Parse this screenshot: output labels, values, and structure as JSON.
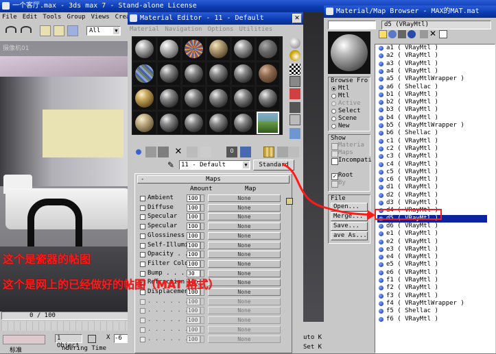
{
  "main_window": {
    "title": "一个客厅.max - 3ds max 7 - Stand-alone License",
    "menu": [
      "File",
      "Edit",
      "Tools",
      "Group",
      "Views",
      "Create"
    ],
    "selection_filter": "All",
    "viewport_label": "摄像机01"
  },
  "timeline": {
    "frame_readout": "0 / 100"
  },
  "status_bar": {
    "objects": "1 Object",
    "x_label": "X",
    "x_value": "-6",
    "prompt": "标准",
    "render_text": "ndering Time"
  },
  "material_editor": {
    "title": "Material Editor - 11 - Default",
    "menu": [
      "Material",
      "Navigation",
      "Options",
      "Utilities"
    ],
    "material_name": "11 - Default",
    "type_button": "Standard",
    "rollout_title": "Maps",
    "col_amount": "Amount",
    "col_map": "Map",
    "maps": [
      {
        "label": "Ambient",
        "amount": "100"
      },
      {
        "label": "Diffuse",
        "amount": "100"
      },
      {
        "label": "Specular",
        "amount": "100"
      },
      {
        "label": "Specular",
        "amount": "100"
      },
      {
        "label": "Glossiness",
        "amount": "100"
      },
      {
        "label": "Self-Illumin",
        "amount": "100"
      },
      {
        "label": "Opacity . .",
        "amount": "100"
      },
      {
        "label": "Filter Color",
        "amount": "100"
      },
      {
        "label": "Bump . . .",
        "amount": "30"
      },
      {
        "label": "Refraction",
        "amount": "100"
      },
      {
        "label": "Displacement",
        "amount": "100"
      },
      {
        "label": ". . . . . .",
        "amount": "100"
      },
      {
        "label": ". . . . . .",
        "amount": "100"
      },
      {
        "label": ". . . . . .",
        "amount": "100"
      },
      {
        "label": ". . . . . .",
        "amount": "100"
      },
      {
        "label": ". . . . . .",
        "amount": "100"
      }
    ],
    "none_label": "None"
  },
  "browser": {
    "title": "Material/Map Browser - MAX的MAT.mat",
    "selected_name": "d5 (VRayMtl)",
    "browse_from": {
      "title": "Browse Fro",
      "options": [
        "Mtl",
        "Mtl",
        "Active",
        "Select",
        "Scene",
        "New"
      ]
    },
    "show": {
      "title": "Show",
      "options": [
        "Materia",
        "Maps",
        "Incompati"
      ]
    },
    "root_options": [
      "Root",
      "By"
    ],
    "file": {
      "title": "File",
      "buttons": [
        "Open...",
        "Merge...",
        "Save...",
        "ave As..."
      ]
    },
    "items": [
      {
        "name": "a1",
        "type": "( VRayMtl )"
      },
      {
        "name": "a2",
        "type": "( VRayMtl )"
      },
      {
        "name": "a3",
        "type": "( VRayMtl )"
      },
      {
        "name": "a4",
        "type": "( VRayMtl )"
      },
      {
        "name": "a5",
        "type": "( VRayMtlWrapper )"
      },
      {
        "name": "a6",
        "type": "( Shellac )"
      },
      {
        "name": "b1",
        "type": "( VRayMtl )"
      },
      {
        "name": "b2",
        "type": "( VRayMtl )"
      },
      {
        "name": "b3",
        "type": "( VRayMtl )"
      },
      {
        "name": "b4",
        "type": "( VRayMtl )"
      },
      {
        "name": "b5",
        "type": "( VRayMtlWrapper )"
      },
      {
        "name": "b6",
        "type": "( Shellac )"
      },
      {
        "name": "c1",
        "type": "( VRayMtl )"
      },
      {
        "name": "c2",
        "type": "( VRayMtl )"
      },
      {
        "name": "c3",
        "type": "( VRayMtl )"
      },
      {
        "name": "c4",
        "type": "( VRayMtl )"
      },
      {
        "name": "c5",
        "type": "( VRayMtl )"
      },
      {
        "name": "c6",
        "type": "( VRayMtl )"
      },
      {
        "name": "d1",
        "type": "( VRayMtl )"
      },
      {
        "name": "d2",
        "type": "( VRayMtl )"
      },
      {
        "name": "d3",
        "type": "( VRayMtl )"
      },
      {
        "name": "d4",
        "type": "( VRayMtl )"
      },
      {
        "name": "d5",
        "type": "( VRayMtl )"
      },
      {
        "name": "d6",
        "type": "( VRayMtl )"
      },
      {
        "name": "e1",
        "type": "( VRayMtl )"
      },
      {
        "name": "e2",
        "type": "( VRayMtl )"
      },
      {
        "name": "e3",
        "type": "( VRayMtl )"
      },
      {
        "name": "e4",
        "type": "( VRayMtl )"
      },
      {
        "name": "e5",
        "type": "( VRayMtl )"
      },
      {
        "name": "e6",
        "type": "( VRayMtl )"
      },
      {
        "name": "f1",
        "type": "( VRayMtl )"
      },
      {
        "name": "f2",
        "type": "( VRayMtl )"
      },
      {
        "name": "f3",
        "type": "( VRayMtl )"
      },
      {
        "name": "f4",
        "type": "( VRayMtlWrapper )"
      },
      {
        "name": "f5",
        "type": "( Shellac )"
      },
      {
        "name": "f6",
        "type": "( VRayMtl )"
      }
    ]
  },
  "annotations": {
    "line1": "这个是瓷器的帖图",
    "line2": "这个是网上的已经做好的帖图（MAT 格式）",
    "color": "#ff1a1a"
  }
}
